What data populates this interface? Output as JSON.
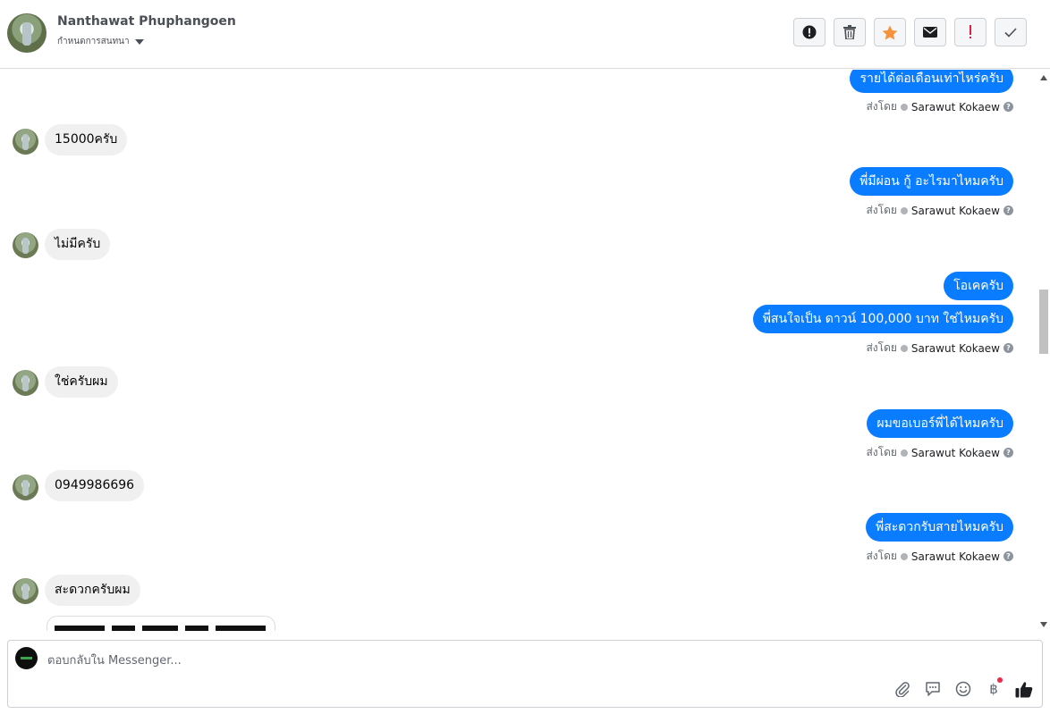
{
  "header": {
    "name": "Nanthawat Phuphangoen",
    "subtitle": "กำหนดการสนทนา"
  },
  "toolbar": {
    "buttons": [
      {
        "icon": "exclamation-circle-icon"
      },
      {
        "icon": "trash-icon"
      },
      {
        "icon": "star-icon",
        "color": "#f7923b"
      },
      {
        "icon": "envelope-icon"
      },
      {
        "icon": "exclamation-icon",
        "color": "#e41e3f"
      },
      {
        "icon": "check-icon"
      }
    ]
  },
  "sent_by_label": "ส่งโดย",
  "sender": "Sarawut Kokaew",
  "messages": {
    "out1": "รายได้ต่อเดือนเท่าไหร่ครับ",
    "in1": "15000ครับ",
    "out2": "พี่มีผ่อน กู้ อะไรมาไหมครับ",
    "in2": "ไม่มีครับ",
    "out3a": "โอเคครับ",
    "out3b": "พี่สนใจเป็น ดาวน์ 100,000 บาท ใช่ไหมครับ",
    "in3": "ใช่ครับผม",
    "out4": "ผมขอเบอร์พี่ได้ไหมครับ",
    "in4": "0949986696",
    "out5": "พี่สะดวกรับสายไหมครับ",
    "in5": "สะดวกครับผม"
  },
  "composer": {
    "placeholder": "ตอบกลับใน Messenger...",
    "actions": [
      "paperclip-icon",
      "saved-reply-icon",
      "emoji-icon",
      "baht-icon",
      "like-icon"
    ],
    "baht_symbol": "฿"
  },
  "colors": {
    "outgoing_bubble": "#0a7cff",
    "incoming_bubble": "#f0f0f0"
  }
}
